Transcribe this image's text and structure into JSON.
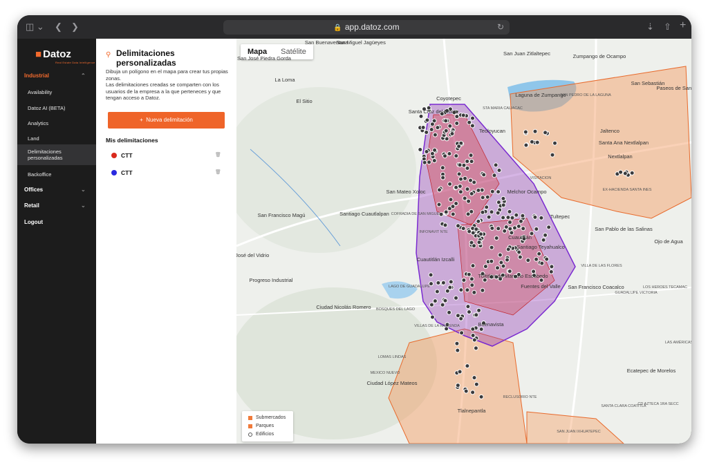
{
  "browser": {
    "url": "app.datoz.com"
  },
  "nav": {
    "logo": "Datoz",
    "logo_sub": "Real Estate Data Intelligence",
    "items": [
      {
        "label": "Industrial"
      },
      {
        "label": "Availability"
      },
      {
        "label": "Datoz AI (BETA)"
      },
      {
        "label": "Analytics"
      },
      {
        "label": "Land"
      },
      {
        "label": "Delimitaciones personalizadas"
      },
      {
        "label": "Backoffice"
      },
      {
        "label": "Offices"
      },
      {
        "label": "Retail"
      },
      {
        "label": "Logout"
      }
    ]
  },
  "panel": {
    "title": "Delimitaciones personalizadas",
    "desc1": "Dibuja un polígono en el mapa para crear tus propias zonas.",
    "desc2": "Las delimitaciones creadas se comparten con los usuarios de la empresa a la que perteneces y que tengan acceso a Datoz.",
    "new_button": "Nueva delimitación",
    "new_button_icon": "+",
    "my_title": "Mis delimitaciones",
    "items": [
      {
        "label": "CTT",
        "color": "#d9291c"
      },
      {
        "label": "CTT",
        "color": "#2a2ae0"
      }
    ]
  },
  "map": {
    "types": [
      "Mapa",
      "Satélite"
    ],
    "legend": [
      {
        "label": "Submercados",
        "color": "#f07a3a"
      },
      {
        "label": "Parques",
        "color": "#f07a3a"
      },
      {
        "label": "Edificios",
        "color": "#555555"
      }
    ],
    "labels": [
      "San Buenaventura",
      "San Miguel Jagüeyes",
      "San José Piedra Gorda",
      "La Loma",
      "El Sitio",
      "Coyotepec",
      "Santa Cruz del Monte",
      "STA MARIA CALIACAC",
      "San Juan Zitlaltepec",
      "Zumpango de Ocampo",
      "Laguna de Zumpango",
      "SAN PEDRO DE LA LAGUNA",
      "San Sebastián",
      "Teoloyucan",
      "Jaltenco",
      "Santa Ana Nextlalpan",
      "Nextlalpan",
      "VISITACION",
      "EX-HACIENDA SANTA INES",
      "San Mateo Xoloc",
      "Melchor Ocampo",
      "San Francisco Magú",
      "Santiago Cuautlalpan",
      "COFRADIA DE SAN MIGUEL",
      "INFONAVIT NTE",
      "Tultepec",
      "San Pablo de las Salinas",
      "Cuautitlán",
      "San José del Vidrio",
      "Santiago Teyahualco",
      "Cuautitlán Izcalli",
      "VILLA DE LAS FLORES",
      "Progreso Industrial",
      "LAGO DE GUADALUPE",
      "Tultitlán de Mariano Escobedo",
      "Fuentes del Valle",
      "San Francisco Coacalco",
      "Ciudad Nicolás Romero",
      "BOSQUES DEL LAGO",
      "Buenavista",
      "VILLAS DE LA HACIENDA",
      "LOMAS LINDAS",
      "MEXICO NUEVO",
      "Ciudad López Mateos",
      "Tlalnepantla",
      "Ecatepec de Morelos",
      "LOS HEROES TECAMAC",
      "GUADALUPE VICTORIA",
      "Ojo de Agua",
      "SAN JUAN IXHUATEPEC",
      "SANTA CLARA COATITLA",
      "CD AZTECA 1RA SECC",
      "RECLUSORIO NTE",
      "LAS AMÉRICAS",
      "Paseos de San Juan"
    ]
  }
}
